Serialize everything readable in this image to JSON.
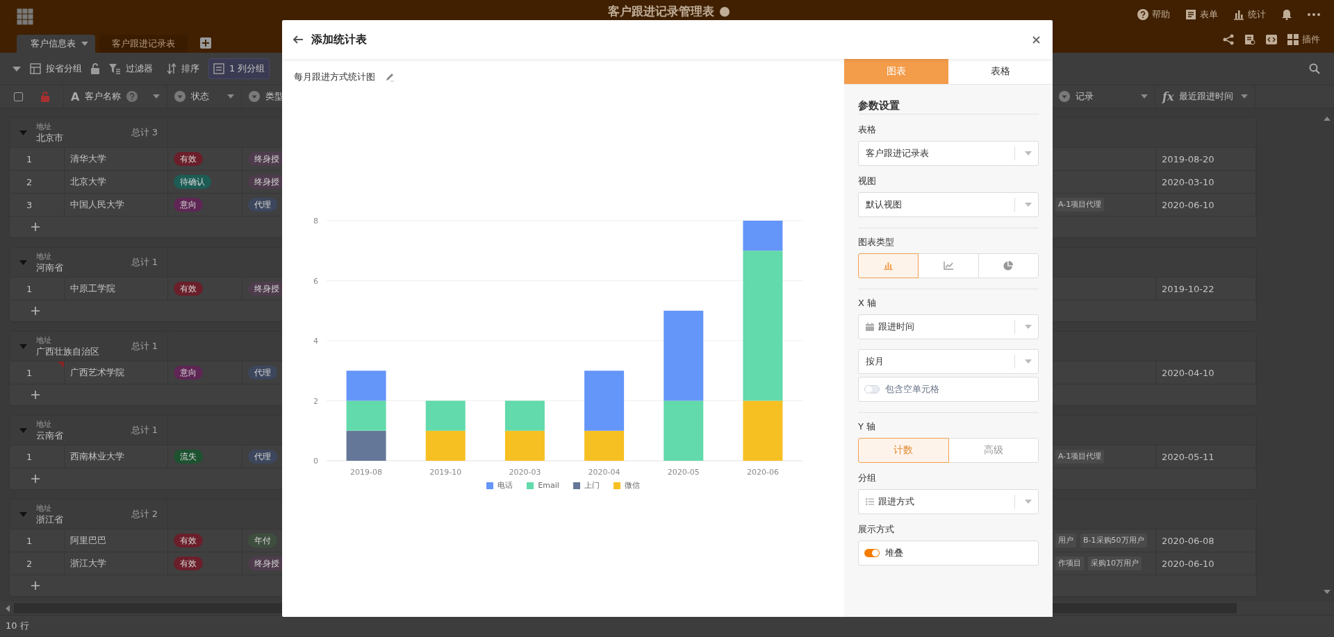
{
  "app": {
    "title": "客户跟进记录管理表",
    "actions": [
      {
        "label": "帮助"
      },
      {
        "label": "表单"
      },
      {
        "label": "统计"
      }
    ],
    "plugin_label": "插件"
  },
  "sheet_tabs": [
    {
      "label": "客户信息表",
      "selected": true
    },
    {
      "label": "客户跟进记录表",
      "selected": false
    }
  ],
  "toolbar": [
    {
      "label": "按省分组",
      "active": false
    },
    {
      "label": "过滤器",
      "active": false
    },
    {
      "label": "排序",
      "active": false
    },
    {
      "label": "1 列分组",
      "active": true
    }
  ],
  "select_all": {
    "checked": false
  },
  "columns": [
    {
      "label": "客户名称",
      "glyph": "A"
    },
    {
      "label": "状态"
    },
    {
      "label": "类型"
    },
    {
      "label": "记录"
    },
    {
      "label": "最近跟进时间",
      "glyph": "fx"
    }
  ],
  "groups": [
    {
      "field": "地址",
      "name": "北京市",
      "total": "总计 3",
      "rows": [
        {
          "index": "1",
          "name": "清华大学",
          "status": {
            "label": "有效",
            "color": "#6a1f2a"
          },
          "type": {
            "label": "终身授",
            "color": "#4e3c4c"
          },
          "last_date": "2019-08-20"
        },
        {
          "index": "2",
          "name": "北京大学",
          "status": {
            "label": "待确认",
            "color": "#1c5c54"
          },
          "type": {
            "label": "终身授",
            "color": "#4e3c4c"
          },
          "last_date": "2020-03-10"
        },
        {
          "index": "3",
          "name": "中国人民大学",
          "status": {
            "label": "意向",
            "color": "#5e2654"
          },
          "type": {
            "label": "代理",
            "color": "#3c465c"
          },
          "records": [
            "A-1项目代理"
          ],
          "last_date": "2020-06-10"
        }
      ]
    },
    {
      "field": "地址",
      "name": "河南省",
      "total": "总计 1",
      "rows": [
        {
          "index": "1",
          "name": "中原工学院",
          "status": {
            "label": "有效",
            "color": "#6a1f2a"
          },
          "type": {
            "label": "终身授",
            "color": "#4e3c4c"
          },
          "last_date": "2019-10-22"
        }
      ]
    },
    {
      "field": "地址",
      "name": "广西壮族自治区",
      "total": "总计 1",
      "rows": [
        {
          "index": "1",
          "name": "广西艺术学院",
          "flagged": true,
          "status": {
            "label": "意向",
            "color": "#5e2654"
          },
          "type": {
            "label": "代理",
            "color": "#3c465c"
          },
          "last_date": "2020-04-10"
        }
      ]
    },
    {
      "field": "地址",
      "name": "云南省",
      "total": "总计 1",
      "rows": [
        {
          "index": "1",
          "name": "西南林业大学",
          "status": {
            "label": "流失",
            "color": "#1d5230"
          },
          "type": {
            "label": "代理",
            "color": "#3c465c"
          },
          "records": [
            "A-1项目代理"
          ],
          "last_date": "2020-05-11"
        }
      ]
    },
    {
      "field": "地址",
      "name": "浙江省",
      "total": "总计 2",
      "rows": [
        {
          "index": "1",
          "name": "阿里巴巴",
          "status": {
            "label": "有效",
            "color": "#6a1f2a"
          },
          "type": {
            "label": "年付",
            "color": "#3e4e3e"
          },
          "records": [
            "用户",
            "B-1采购50万用户"
          ],
          "last_date": "2020-06-08"
        },
        {
          "index": "2",
          "name": "浙江大学",
          "status": {
            "label": "有效",
            "color": "#6a1f2a"
          },
          "type": {
            "label": "终身授",
            "color": "#4e3c4c"
          },
          "records": [
            "作项目",
            "采购10万用户"
          ],
          "last_date": "2020-06-10"
        }
      ]
    }
  ],
  "row_count": "10 行",
  "modal": {
    "title": "添加统计表",
    "chart_title": "每月跟进方式统计图",
    "chart_data": {
      "type": "bar",
      "categories": [
        "2019-08",
        "2019-10",
        "2020-03",
        "2020-04",
        "2020-05",
        "2020-06"
      ],
      "stacked": true,
      "grid": true,
      "legend": "bottom",
      "ylim": [
        0,
        8
      ],
      "yticks": [
        0,
        2,
        4,
        6,
        8
      ],
      "series": [
        {
          "name": "电话",
          "color": "#6495f9",
          "values": [
            1,
            0,
            0,
            2,
            3,
            1
          ]
        },
        {
          "name": "Email",
          "color": "#62daab",
          "values": [
            1,
            1,
            1,
            0,
            2,
            5
          ]
        },
        {
          "name": "上门",
          "color": "#657798",
          "values": [
            1,
            0,
            0,
            0,
            0,
            0
          ]
        },
        {
          "name": "微信",
          "color": "#f6c022",
          "values": [
            0,
            1,
            1,
            1,
            0,
            2
          ]
        }
      ]
    },
    "panel": {
      "tabs": [
        {
          "label": "图表",
          "selected": true
        },
        {
          "label": "表格",
          "selected": false
        }
      ],
      "heading": "参数设置",
      "fields": [
        {
          "kind": "select",
          "label": "表格",
          "value": "客户跟进记录表"
        },
        {
          "kind": "select",
          "label": "视图",
          "value": "默认视图"
        },
        {
          "kind": "divider"
        },
        {
          "kind": "chart-type",
          "label": "图表类型",
          "options": [
            {
              "selected": true
            },
            {
              "selected": false
            },
            {
              "selected": false
            }
          ]
        },
        {
          "kind": "divider"
        },
        {
          "kind": "date-select",
          "label": "X 轴",
          "value": "跟进时间"
        },
        {
          "kind": "select",
          "value": "按月"
        },
        {
          "kind": "toggle",
          "value": "包含空单元格",
          "on": false
        },
        {
          "kind": "divider"
        },
        {
          "kind": "segmented",
          "label": "Y 轴",
          "options": [
            {
              "label": "计数",
              "selected": true
            },
            {
              "label": "高级",
              "selected": false
            }
          ]
        },
        {
          "kind": "list-select",
          "label": "分组",
          "value": "跟进方式"
        },
        {
          "kind": "toggle",
          "label": "展示方式",
          "value": "堆叠",
          "on": true
        }
      ]
    }
  }
}
